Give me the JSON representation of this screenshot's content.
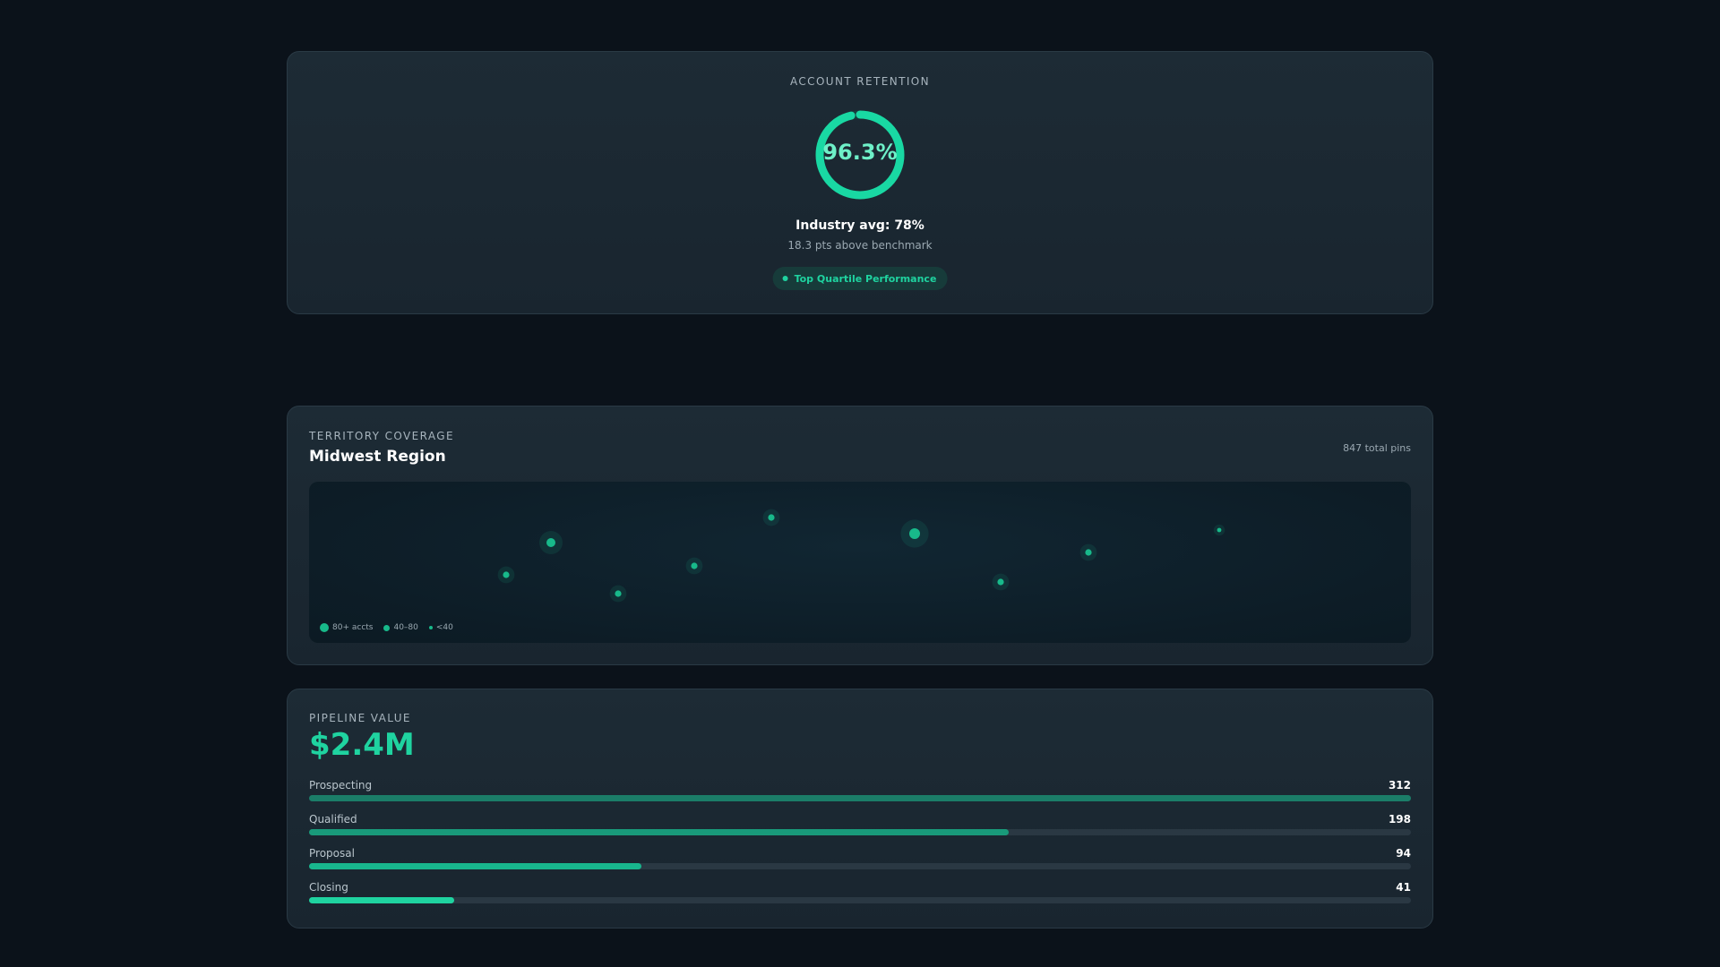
{
  "retention": {
    "eyebrow": "ACCOUNT RETENTION",
    "value_label": "96.3%",
    "value": 96.3,
    "industry": "Industry avg: 78%",
    "benchmark": "18.3 pts above benchmark",
    "badge": "Top Quartile Performance"
  },
  "territory": {
    "eyebrow": "TERRITORY COVERAGE",
    "title": "Midwest Region",
    "pins": "847 total pins",
    "legend": [
      {
        "label": "80+ accts",
        "tier": "large"
      },
      {
        "label": "40–80",
        "tier": "medium"
      },
      {
        "label": "<40",
        "tier": "small"
      }
    ],
    "pins_map": [
      {
        "tier": "medium"
      },
      {
        "tier": "small"
      },
      {
        "tier": "small"
      },
      {
        "tier": "small"
      },
      {
        "tier": "small"
      },
      {
        "tier": "large"
      },
      {
        "tier": "small"
      },
      {
        "tier": "small"
      },
      {
        "tier": "tiny"
      }
    ]
  },
  "pipeline": {
    "eyebrow": "PIPELINE VALUE",
    "total": "$2.4M",
    "stages": [
      {
        "label": "Prospecting",
        "count": "312",
        "value": 312,
        "color": "#1b7d68"
      },
      {
        "label": "Qualified",
        "count": "198",
        "value": 198,
        "color": "#199a7a"
      },
      {
        "label": "Proposal",
        "count": "94",
        "value": 94,
        "color": "#18b68d"
      },
      {
        "label": "Closing",
        "count": "41",
        "value": 41,
        "color": "#1fd3a0"
      }
    ],
    "max": 312
  },
  "colors": {
    "accent": "#1fd3a0",
    "ring": "#19d8a3",
    "pin": "#18b98a"
  }
}
